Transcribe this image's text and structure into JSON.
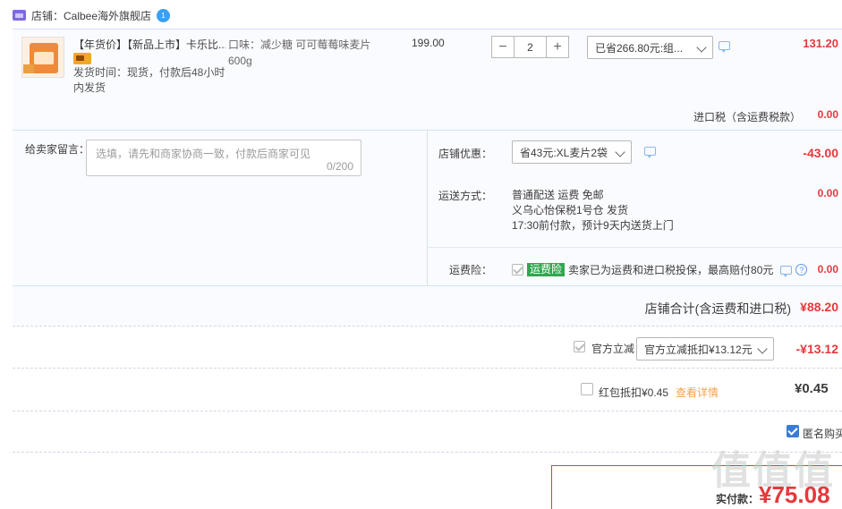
{
  "shop": {
    "name": "店铺：Calbee海外旗舰店",
    "ww_badge": "1"
  },
  "item": {
    "title": "【年货价】【新品上市】卡乐比...",
    "ship_time": "发货时间：现货，付款后48小时内发货",
    "sku": "口味：减少糖 可可莓莓味麦片600g",
    "unit_price": "199.00",
    "qty_minus": "−",
    "qty_value": "2",
    "qty_plus": "+",
    "discount_select": "已省266.80元:组...",
    "subtotal": "131.20"
  },
  "tax": {
    "label": "进口税（含运费税款）",
    "amount": "0.00"
  },
  "message": {
    "label": "给卖家留言：",
    "placeholder": "选填，请先和商家协商一致，付款后商家可见",
    "count": "0/200"
  },
  "shop_discount": {
    "label": "店铺优惠：",
    "select": "省43元:XL麦片2袋",
    "amount": "-43.00"
  },
  "shipping": {
    "label": "运送方式：",
    "line1": "普通配送 运费 免邮",
    "line2": "义乌心怡保税1号仓   发货",
    "line3": "17:30前付款，预计9天内送货上门",
    "amount": "0.00"
  },
  "insurance": {
    "label": "运费险：",
    "badge": "运费险",
    "text": "卖家已为运费和进口税投保，最高赔付80元",
    "help": "?",
    "amount": "0.00"
  },
  "shop_total": {
    "label": "店铺合计(含运费和进口税)",
    "amount": "¥88.20"
  },
  "official_discount": {
    "label": "官方立减",
    "select": "官方立减抵扣¥13.12元",
    "amount": "-¥13.12"
  },
  "red_packet": {
    "label": "红包抵扣¥0.45",
    "link": "查看详情",
    "amount": "¥0.45"
  },
  "anonymous": {
    "label": "匿名购买"
  },
  "payment": {
    "label": "实付款：",
    "amount": "¥75.08"
  },
  "watermark": "值值值",
  "colors": {
    "price_red": "#e4393c",
    "panel_bg": "#fafbff",
    "accent_blue": "#3a7bd5",
    "ins_green": "#2fa84f"
  }
}
